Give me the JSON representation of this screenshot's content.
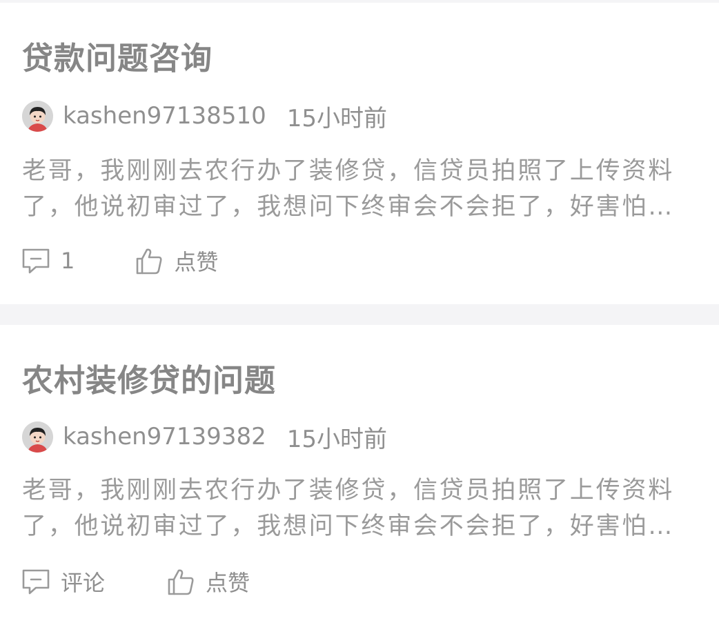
{
  "posts": [
    {
      "title": "贷款问题咨询",
      "username": "kashen97138510",
      "time": "15小时前",
      "excerpt_line1": "老哥，我刚刚去农行办了装修贷，信贷员拍照了上传资料",
      "excerpt_line2": "了，他说初审过了，我想问下终审会不会拒了，好害怕…",
      "comment_label": "1",
      "like_label": "点赞",
      "comment_icon": "comment-icon",
      "like_icon": "thumbs-up-icon"
    },
    {
      "title": "农村装修贷的问题",
      "username": "kashen97139382",
      "time": "15小时前",
      "excerpt_line1": "老哥，我刚刚去农行办了装修贷，信贷员拍照了上传资料",
      "excerpt_line2": "了，他说初审过了，我想问下终审会不会拒了，好害怕…",
      "comment_label": "评论",
      "like_label": "点赞",
      "comment_icon": "comment-icon",
      "like_icon": "thumbs-up-icon"
    }
  ],
  "colors": {
    "text_primary": "#868686",
    "text_secondary": "#9a9a9a",
    "separator": "#f4f4f6",
    "background": "#ffffff"
  }
}
